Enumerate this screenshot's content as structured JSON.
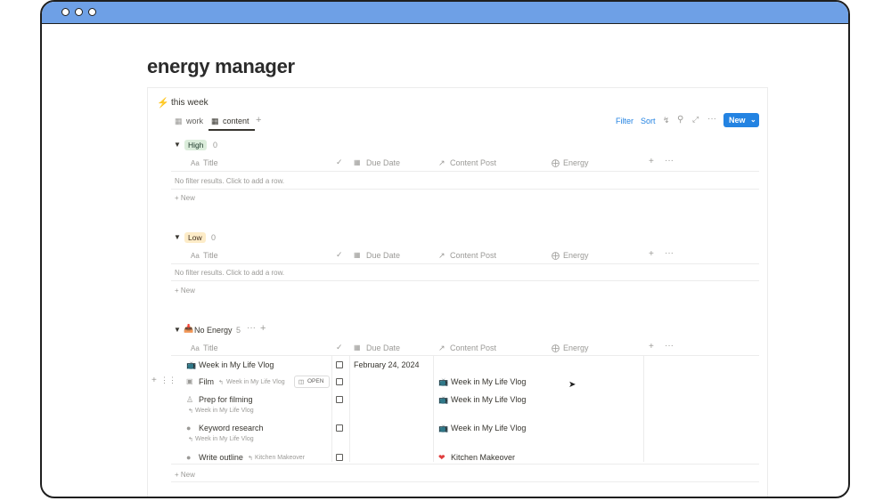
{
  "window": {
    "dots": 3
  },
  "page": {
    "title": "energy manager"
  },
  "database": {
    "title": "this week",
    "tabs": [
      {
        "label": "work"
      },
      {
        "label": "content"
      }
    ],
    "toolbar": {
      "filter": "Filter",
      "sort": "Sort",
      "new": "New"
    },
    "columns": {
      "title": "Title",
      "due_date": "Due Date",
      "content_post": "Content Post",
      "energy": "Energy"
    },
    "empty_text": "No filter results. Click to add a row.",
    "new_row": "New",
    "groups": [
      {
        "label": "High",
        "count": "0",
        "color": "#dbeddb"
      },
      {
        "label": "Low",
        "count": "0",
        "color": "#fdecc8"
      },
      {
        "label": "No Energy",
        "count": "5"
      }
    ],
    "rows": [
      {
        "title": "Week in My Life Vlog",
        "parent": "",
        "due_date": "February 24, 2024",
        "content_post": ""
      },
      {
        "title": "Film",
        "parent": "Week in My Life Vlog",
        "due_date": "",
        "content_post": "Week in My Life Vlog",
        "badge": "OPEN"
      },
      {
        "title": "Prep for filming",
        "parent": "Week in My Life Vlog",
        "due_date": "",
        "content_post": "Week in My Life Vlog"
      },
      {
        "title": "Keyword research",
        "parent": "Week in My Life Vlog",
        "due_date": "",
        "content_post": "Week in My Life Vlog"
      },
      {
        "title": "Write outline",
        "parent": "Kitchen Makeover",
        "due_date": "",
        "content_post": "Kitchen Makeover"
      }
    ]
  }
}
